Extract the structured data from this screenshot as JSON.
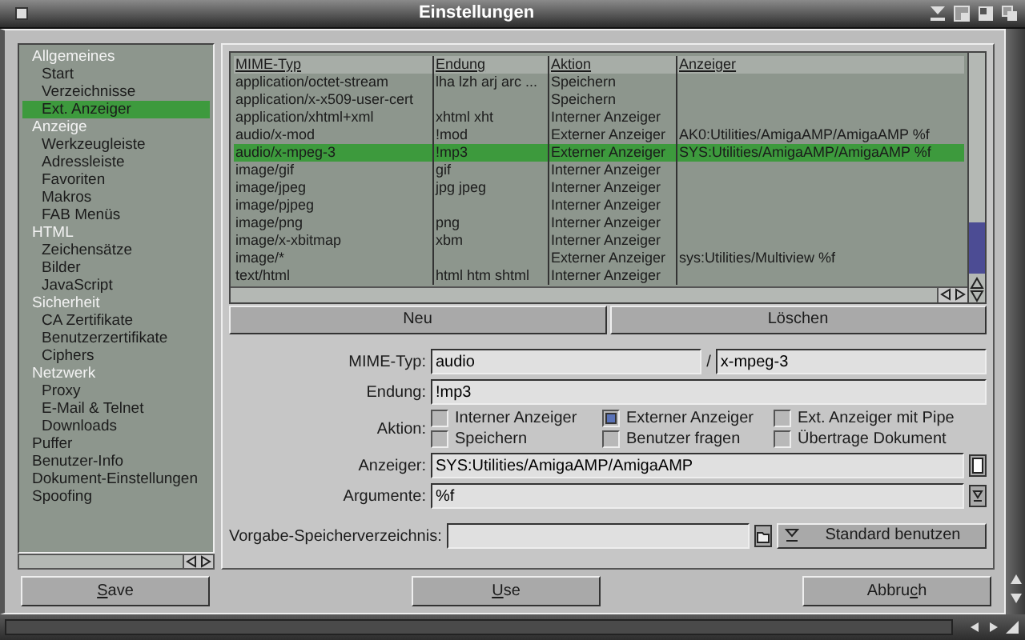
{
  "window": {
    "title": "Einstellungen"
  },
  "sidebar": {
    "items": [
      {
        "label": "Allgemeines",
        "selected": false,
        "children": [
          {
            "label": "Start",
            "selected": false
          },
          {
            "label": "Verzeichnisse",
            "selected": false
          },
          {
            "label": "Ext. Anzeiger",
            "selected": true
          }
        ]
      },
      {
        "label": "Anzeige",
        "selected": false,
        "children": [
          {
            "label": "Werkzeugleiste",
            "selected": false
          },
          {
            "label": "Adressleiste",
            "selected": false
          },
          {
            "label": "Favoriten",
            "selected": false
          },
          {
            "label": "Makros",
            "selected": false
          },
          {
            "label": "FAB Menüs",
            "selected": false
          }
        ]
      },
      {
        "label": "HTML",
        "selected": false,
        "children": [
          {
            "label": "Zeichensätze",
            "selected": false
          },
          {
            "label": "Bilder",
            "selected": false
          },
          {
            "label": "JavaScript",
            "selected": false
          }
        ]
      },
      {
        "label": "Sicherheit",
        "selected": false,
        "children": [
          {
            "label": "CA Zertifikate",
            "selected": false
          },
          {
            "label": "Benutzerzertifikate",
            "selected": false
          },
          {
            "label": "Ciphers",
            "selected": false
          }
        ]
      },
      {
        "label": "Netzwerk",
        "selected": false,
        "children": [
          {
            "label": "Proxy",
            "selected": false
          },
          {
            "label": "E-Mail & Telnet",
            "selected": false
          },
          {
            "label": "Downloads",
            "selected": false
          }
        ]
      },
      {
        "label": "Puffer",
        "selected": false
      },
      {
        "label": "Benutzer-Info",
        "selected": false
      },
      {
        "label": "Dokument-Einstellungen",
        "selected": false
      },
      {
        "label": "Spoofing",
        "selected": false
      }
    ]
  },
  "table": {
    "columns": [
      "MIME-Typ",
      "Endung",
      "Aktion",
      "Anzeiger"
    ],
    "rows": [
      {
        "mime": "application/octet-stream",
        "extension": "lha lzh arj arc ...",
        "action": "Speichern",
        "selected": false
      },
      {
        "mime": "application/x-x509-user-cert",
        "action": "Speichern",
        "selected": false
      },
      {
        "mime": "application/xhtml+xml",
        "extension": "xhtml xht",
        "action": "Interner Anzeiger",
        "selected": false
      },
      {
        "mime": "audio/x-mod",
        "extension": "!mod",
        "action": "Externer Anzeiger",
        "viewer": "AK0:Utilities/AmigaAMP/AmigaAMP %f",
        "selected": false
      },
      {
        "mime": "audio/x-mpeg-3",
        "extension": "!mp3",
        "action": "Externer Anzeiger",
        "viewer": "SYS:Utilities/AmigaAMP/AmigaAMP %f",
        "selected": true
      },
      {
        "mime": "image/gif",
        "extension": "gif",
        "action": "Interner Anzeiger",
        "selected": false
      },
      {
        "mime": "image/jpeg",
        "extension": "jpg jpeg",
        "action": "Interner Anzeiger",
        "selected": false
      },
      {
        "mime": "image/pjpeg",
        "action": "Interner Anzeiger",
        "selected": false
      },
      {
        "mime": "image/png",
        "extension": "png",
        "action": "Interner Anzeiger",
        "selected": false
      },
      {
        "mime": "image/x-xbitmap",
        "extension": "xbm",
        "action": "Interner Anzeiger",
        "selected": false
      },
      {
        "mime": "image/*",
        "action": "Externer Anzeiger",
        "viewer": "sys:Utilities/Multiview %f",
        "selected": false
      },
      {
        "mime": "text/html",
        "extension": "html htm shtml",
        "action": "Interner Anzeiger",
        "selected": false
      }
    ]
  },
  "table_buttons": [
    "Neu",
    "Löschen"
  ],
  "form": {
    "mime_type": {
      "label": "MIME-Typ:",
      "value": "audio",
      "separator": "/",
      "subtype": "x-mpeg-3"
    },
    "extension": {
      "label": "Endung:",
      "value": "!mp3"
    },
    "action": {
      "label": "Aktion:",
      "options": [
        {
          "label": "Interner Anzeiger",
          "checked": false
        },
        {
          "label": "Externer Anzeiger",
          "checked": true
        },
        {
          "label": "Ext. Anzeiger mit Pipe",
          "checked": false
        },
        {
          "label": "Speichern",
          "checked": false
        },
        {
          "label": "Benutzer fragen",
          "checked": false
        },
        {
          "label": "Übertrage Dokument",
          "checked": false
        }
      ]
    },
    "viewer": {
      "label": "Anzeiger:",
      "value": "SYS:Utilities/AmigaAMP/AmigaAMP"
    },
    "arguments": {
      "label": "Argumente:",
      "value": "%f"
    },
    "save_dir": {
      "label": "Vorgabe-Speicherverzeichnis:",
      "default_button": "Standard benutzen"
    }
  },
  "buttons": [
    {
      "key": "S",
      "post": "ave"
    },
    {
      "key": "U",
      "post": "se"
    },
    {
      "pre": "Abbru",
      "key": "c",
      "post": "h"
    }
  ]
}
